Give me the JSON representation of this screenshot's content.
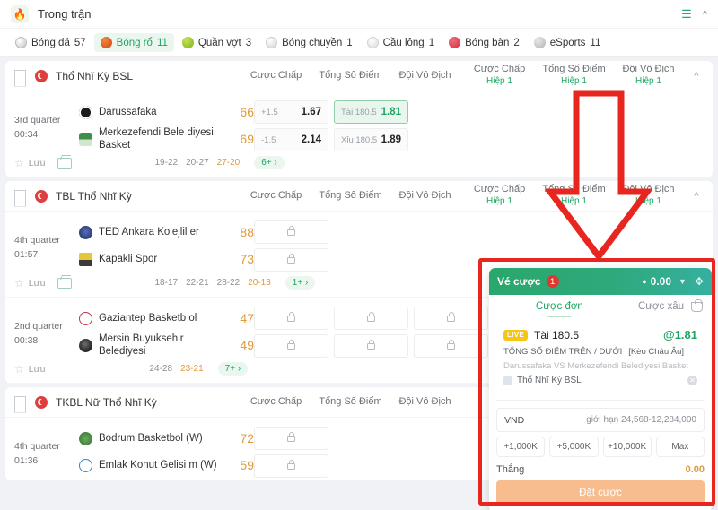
{
  "header": {
    "title": "Trong trận",
    "flame_icon": "flame-icon",
    "menu_icon": "list-menu-icon",
    "collapse_icon": "chevron-up-icon"
  },
  "sports_tabs": [
    {
      "label": "Bóng đá",
      "count": "57",
      "ball": "soccer",
      "active": false
    },
    {
      "label": "Bóng rổ",
      "count": "11",
      "ball": "basket",
      "active": true
    },
    {
      "label": "Quần vợt",
      "count": "3",
      "ball": "tennis",
      "active": false
    },
    {
      "label": "Bóng chuyền",
      "count": "1",
      "ball": "volley",
      "active": false
    },
    {
      "label": "Cầu lông",
      "count": "1",
      "ball": "badminton",
      "active": false
    },
    {
      "label": "Bóng bàn",
      "count": "2",
      "ball": "tabletennis",
      "active": false
    },
    {
      "label": "eSports",
      "count": "11",
      "ball": "esports",
      "active": false
    }
  ],
  "market_headers": {
    "handicap": "Cược Chấp",
    "total": "Tổng Số Điểm",
    "winner": "Đội Vô Địch",
    "half": "Hiệp 1"
  },
  "leagues": [
    {
      "name": "Thổ Nhĩ Kỳ BSL",
      "columns": [
        {
          "title": "Cược Chấp",
          "sub": ""
        },
        {
          "title": "Tổng Số Điểm",
          "sub": ""
        },
        {
          "title": "Đội Vô Địch",
          "sub": ""
        },
        {
          "title": "Cược Chấp",
          "sub": "Hiệp 1"
        },
        {
          "title": "Tổng Số Điểm",
          "sub": "Hiệp 1"
        },
        {
          "title": "Đội Vô Địch",
          "sub": "Hiệp 1"
        }
      ],
      "matches": [
        {
          "period": "3rd quarter",
          "clock": "00:34",
          "home": {
            "name": "Darussafaka",
            "score": "66",
            "logo": "lg-darussafaka"
          },
          "away": {
            "name": "Merkezefendi Bele diyesi Basket",
            "score": "69",
            "logo": "lg-merkez"
          },
          "odds_columns": [
            {
              "locked": false,
              "rows": [
                {
                  "hcp": "+1.5",
                  "price": "1.67",
                  "selected": false
                },
                {
                  "hcp": "-1.5",
                  "price": "2.14",
                  "selected": false
                }
              ]
            },
            {
              "locked": false,
              "rows": [
                {
                  "hcp": "Tài 180.5",
                  "price": "1.81",
                  "selected": true
                },
                {
                  "hcp": "Xỉu 180.5",
                  "price": "1.89",
                  "selected": false
                }
              ]
            }
          ],
          "save_label": "Lưu",
          "periods": [
            "19-22",
            "20-27",
            "27-20"
          ],
          "current_period_index": 2,
          "more_label": "6+"
        }
      ]
    },
    {
      "name": "TBL Thổ Nhĩ Kỳ",
      "columns": [
        {
          "title": "Cược Chấp",
          "sub": ""
        },
        {
          "title": "Tổng Số Điểm",
          "sub": ""
        },
        {
          "title": "Đội Vô Địch",
          "sub": ""
        },
        {
          "title": "Cược Chấp",
          "sub": "Hiệp 1"
        },
        {
          "title": "Tổng Số Điểm",
          "sub": "Hiệp 1"
        },
        {
          "title": "Đội Vô Địch",
          "sub": "Hiệp 1"
        }
      ],
      "matches": [
        {
          "period": "4th quarter",
          "clock": "01:57",
          "home": {
            "name": "TED Ankara Kolejlil er",
            "score": "88",
            "logo": "lg-ted"
          },
          "away": {
            "name": "Kapakli Spor",
            "score": "73",
            "logo": "lg-kapakli"
          },
          "odds_columns": [
            {
              "locked": true,
              "rows": [
                {},
                {}
              ]
            }
          ],
          "save_label": "Lưu",
          "periods": [
            "18-17",
            "22-21",
            "28-22",
            "20-13"
          ],
          "current_period_index": 3,
          "more_label": "1+"
        },
        {
          "period": "2nd quarter",
          "clock": "00:38",
          "home": {
            "name": "Gaziantep Basketb ol",
            "score": "47",
            "logo": "lg-gaziantep"
          },
          "away": {
            "name": "Mersin Buyuksehir Belediyesi",
            "score": "49",
            "logo": "lg-mersin"
          },
          "odds_columns": [
            {
              "locked": true,
              "rows": [
                {},
                {}
              ]
            },
            {
              "locked": true,
              "rows": [
                {},
                {}
              ]
            },
            {
              "locked": true,
              "rows": [
                {},
                {}
              ]
            }
          ],
          "save_label": "Lưu",
          "periods": [
            "24-28",
            "23-21"
          ],
          "current_period_index": 1,
          "more_label": "7+"
        }
      ]
    },
    {
      "name": "TKBL Nữ Thổ Nhĩ Kỳ",
      "columns": [
        {
          "title": "Cược Chấp",
          "sub": ""
        },
        {
          "title": "Tổng Số Điểm",
          "sub": ""
        },
        {
          "title": "Đội Vô Địch",
          "sub": ""
        }
      ],
      "matches": [
        {
          "period": "4th quarter",
          "clock": "01:36",
          "home": {
            "name": "Bodrum Basketbol (W)",
            "score": "72",
            "logo": "lg-bodrum"
          },
          "away": {
            "name": "Emlak Konut Gelisi m (W)",
            "score": "59",
            "logo": "lg-emlak"
          },
          "odds_columns": [
            {
              "locked": true,
              "rows": [
                {},
                {}
              ]
            }
          ],
          "save_label": "Lưu",
          "periods": [],
          "current_period_index": -1,
          "more_label": ""
        }
      ]
    }
  ],
  "betslip": {
    "title": "Vé cược",
    "count": "1",
    "balance": "0.00",
    "coin_icon": "coin-icon",
    "caret_icon": "chevron-down-icon",
    "move_icon": "move-handle-icon",
    "tab_single": "Cược đơn",
    "tab_parlay": "Cược xâu",
    "basket_icon": "basket-icon",
    "selection": {
      "live_tag": "LIVE",
      "name": "Tài 180.5",
      "odds": "@1.81",
      "market": "TỔNG SỐ ĐIỂM TRÊN / DƯỚI",
      "market_type": "[Kèo Châu Âu]",
      "match": "Darussafaka VS Merkezefendi Belediyesi Basket",
      "league": "Thổ Nhĩ Kỳ BSL",
      "remove_icon": "close-icon"
    },
    "currency": "VND",
    "limit": "giới hạn 24,568-12,284,000",
    "quick_amounts": [
      "+1,000K",
      "+5,000K",
      "+10,000K",
      "Max"
    ],
    "win_label": "Thắng",
    "win_value": "0.00",
    "bet_button": "Đặt cược"
  },
  "annotations": {
    "highlight_box": "betslip-highlight-rect",
    "arrow": "down-arrow-annotation",
    "color": "#e8261f"
  }
}
